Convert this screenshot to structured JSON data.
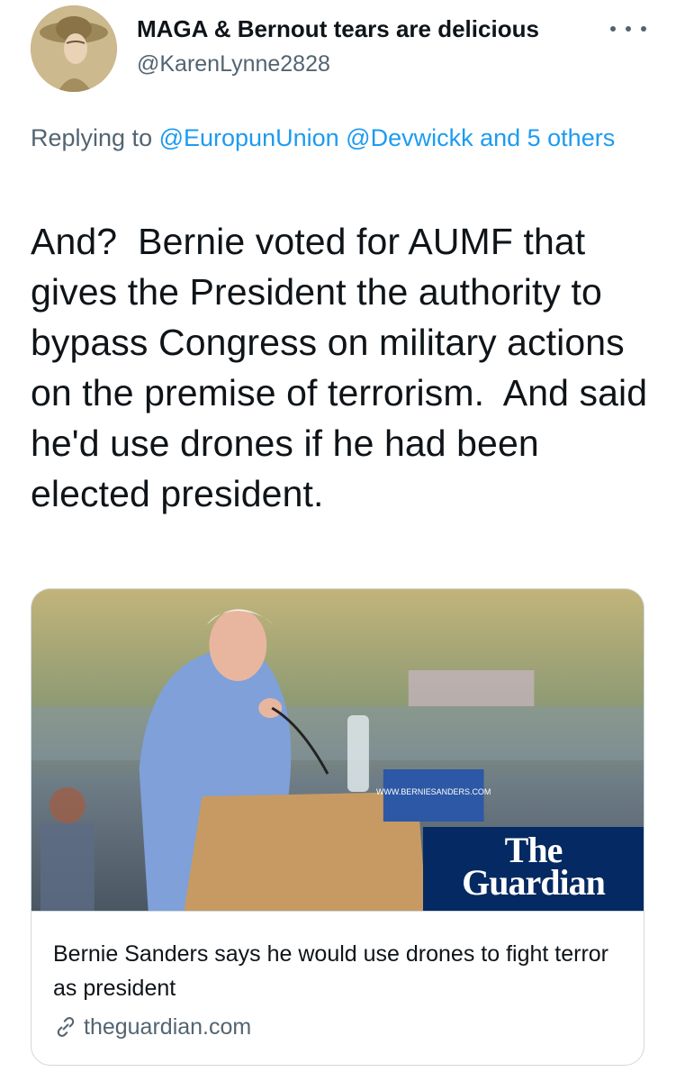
{
  "author": {
    "display_name": "MAGA & Bernout tears are delicious",
    "handle": "@KarenLynne2828"
  },
  "reply": {
    "prefix": "Replying to ",
    "mentions": [
      "@EuropunUnion",
      "@Devwickk"
    ],
    "others_text": "and 5 others"
  },
  "tweet": {
    "text": "And?  Bernie voted for AUMF that gives the President the authority to bypass Congress on military actions on the premise of terrorism.  And said he'd use drones if he had been elected president."
  },
  "card": {
    "image_sign_text": "WWW.BERNIESANDERS.COM",
    "logo_line1": "The",
    "logo_line2": "Guardian",
    "title": "Bernie Sanders says he would use drones to fight terror as president",
    "domain": "theguardian.com"
  },
  "colors": {
    "link": "#1d9bf0",
    "secondary_text": "#536471",
    "guardian_blue": "#052962"
  }
}
